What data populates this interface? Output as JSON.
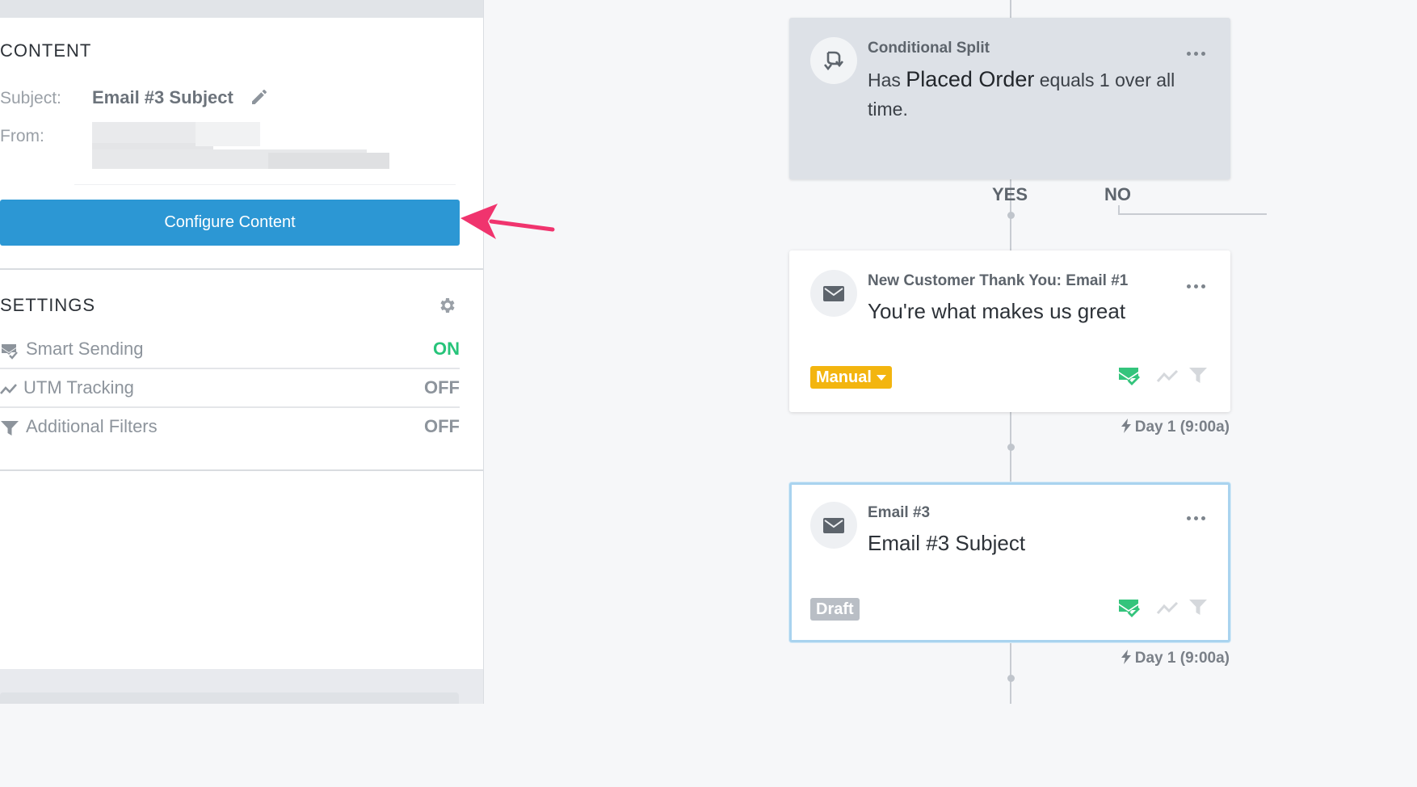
{
  "content": {
    "title": "CONTENT",
    "subject_label": "Subject:",
    "subject_value": "Email #3 Subject",
    "from_label": "From:",
    "configure_label": "Configure Content"
  },
  "settings": {
    "title": "SETTINGS",
    "rows": [
      {
        "label": "Smart Sending",
        "state": "ON",
        "icon": "smart-sending-icon",
        "color": "#27c47a"
      },
      {
        "label": "UTM Tracking",
        "state": "OFF",
        "icon": "utm-tracking-icon",
        "color": "#8d949c"
      },
      {
        "label": "Additional Filters",
        "state": "OFF",
        "icon": "filter-icon",
        "color": "#8d949c"
      }
    ]
  },
  "flow": {
    "split": {
      "kicker": "Conditional Split",
      "rule_prefix": "Has",
      "rule_metric": "Placed Order",
      "rule_suffix": "equals 1 over all time."
    },
    "branches": {
      "yes": "YES",
      "no": "NO"
    },
    "email1": {
      "kicker": "New Customer Thank You: Email #1",
      "subject": "You're what makes us great",
      "status": "Manual",
      "delay": "Day 1 (9:00a)"
    },
    "email3": {
      "kicker": "Email #3",
      "subject": "Email #3 Subject",
      "status": "Draft",
      "delay": "Day 1 (9:00a)"
    }
  },
  "colors": {
    "accent": "#2c97d4",
    "on": "#27c47a",
    "manual": "#f3b50f",
    "arrow": "#f0346e"
  }
}
